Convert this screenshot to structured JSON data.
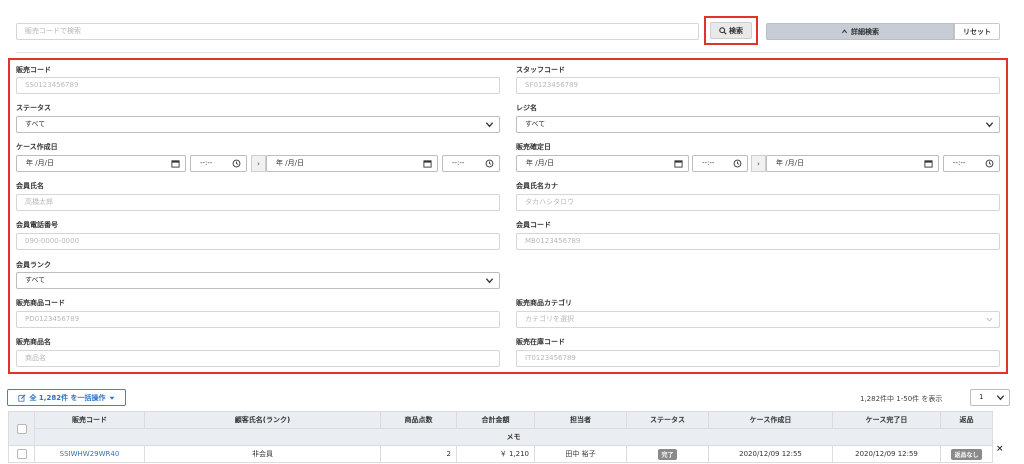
{
  "search": {
    "placeholder": "販売コードで検索",
    "button_label": "検索",
    "advanced_label": "詳細検索",
    "reset_label": "リセット"
  },
  "form": {
    "sales_code": {
      "label": "販売コード",
      "placeholder": "SS0123456789"
    },
    "staff_code": {
      "label": "スタッフコード",
      "placeholder": "SF0123456789"
    },
    "status": {
      "label": "ステータス",
      "value": "すべて"
    },
    "register": {
      "label": "レジ名",
      "value": "すべて"
    },
    "case_created": {
      "label": "ケース作成日",
      "date_from": "年 /月/日",
      "time_from": "--:--",
      "arrow": "›",
      "date_to": "年 /月/日",
      "time_to": "--:--"
    },
    "sales_confirmed": {
      "label": "販売確定日",
      "date_from": "年 /月/日",
      "time_from": "--:--",
      "arrow": "›",
      "date_to": "年 /月/日",
      "time_to": "--:--"
    },
    "member_name": {
      "label": "会員氏名",
      "placeholder": "高橋太郎"
    },
    "member_kana": {
      "label": "会員氏名カナ",
      "placeholder": "タカハシタロウ"
    },
    "member_phone": {
      "label": "会員電話番号",
      "placeholder": "090-0000-0000"
    },
    "member_code": {
      "label": "会員コード",
      "placeholder": "MB0123456789"
    },
    "member_rank": {
      "label": "会員ランク",
      "value": "すべて"
    },
    "product_code": {
      "label": "販売商品コード",
      "placeholder": "PD0123456789"
    },
    "product_category": {
      "label": "販売商品カテゴリ",
      "placeholder": "カテゴリを選択"
    },
    "product_name": {
      "label": "販売商品名",
      "placeholder": "商品名"
    },
    "stock_code": {
      "label": "販売在庫コード",
      "placeholder": "IT0123456789"
    }
  },
  "bulk": {
    "label": "全 1,282件 を一括操作"
  },
  "pagination": {
    "summary": "1,282件中 1-50件 を表示",
    "per_page": "1"
  },
  "table": {
    "headers": [
      "販売コード",
      "顧客氏名(ランク)",
      "商品点数",
      "合計金額",
      "担当者",
      "ステータス",
      "ケース作成日",
      "ケース完了日",
      "返品"
    ],
    "memo_label": "メモ",
    "rows": [
      {
        "code": "SSIWHW29WR40",
        "customer": "非会員",
        "qty": "2",
        "total": "￥ 1,210",
        "staff": "田中 裕子",
        "status": "完了",
        "created": "2020/12/09 12:55",
        "completed": "2020/12/09 12:59",
        "return": "返品なし",
        "close": "×"
      }
    ]
  },
  "colors": {
    "highlight": "#e0332a",
    "link": "#2f72c0",
    "header_bg": "#eaedf1"
  }
}
